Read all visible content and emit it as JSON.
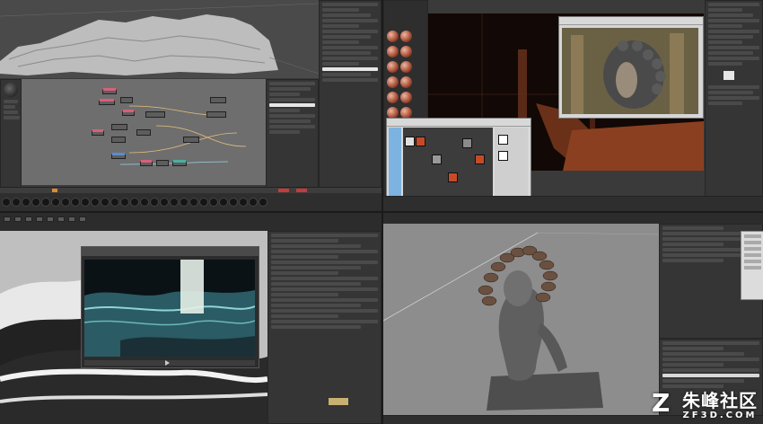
{
  "screens": {
    "top_left": {
      "app": "node-editor-view",
      "nodes": 14
    },
    "top_right": {
      "app": "material-render-view"
    },
    "bottom_left": {
      "app": "ocean-simulation-view"
    },
    "bottom_right": {
      "app": "sculpt-viewport"
    }
  },
  "colors": {
    "bg": "#3a3a3a",
    "node_pink": "#d6607a",
    "node_blue": "#5b8dd0",
    "node_teal": "#4bb0a0",
    "timeline_orange": "#e08a2e",
    "timeline_red": "#c63a3a"
  },
  "watermark": {
    "logo_glyph": "Z",
    "name": "朱峰社区",
    "domain": "ZF3D.COM"
  },
  "icons": [
    "play-icon",
    "key-icon",
    "render-icon",
    "material-ball-icon"
  ]
}
